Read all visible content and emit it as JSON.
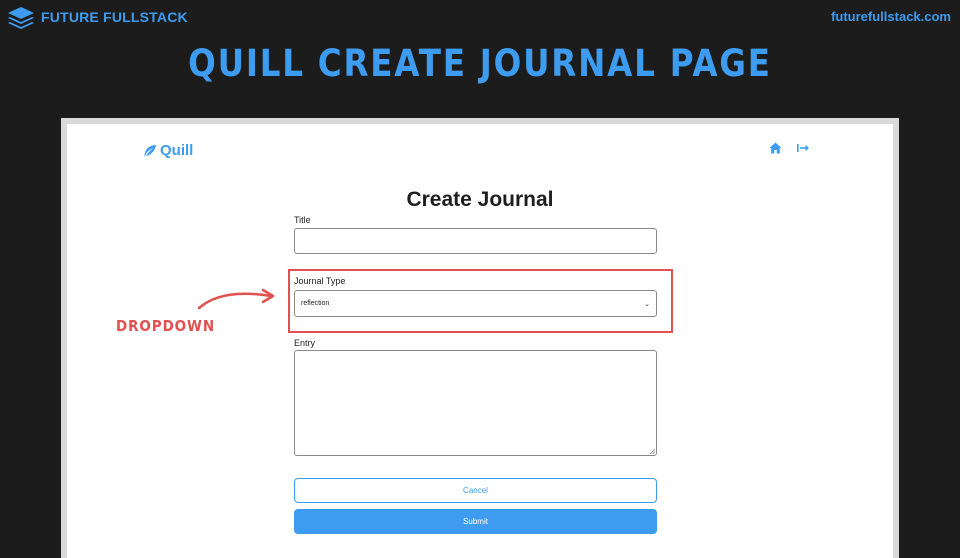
{
  "header": {
    "brand_name": "FUTURE FULLSTACK",
    "site_url": "futurefullstack.com",
    "slide_title": "QUILL CREATE JOURNAL PAGE"
  },
  "app": {
    "logo_text": "Quill",
    "nav": {
      "icons": [
        "home-icon",
        "logout-icon"
      ]
    },
    "page_title": "Create Journal",
    "form": {
      "title_label": "Title",
      "title_value": "",
      "journal_type_label": "Journal Type",
      "journal_type_value": "reflection",
      "entry_label": "Entry",
      "entry_value": "",
      "cancel_label": "Cancel",
      "submit_label": "Submit"
    }
  },
  "annotation": {
    "callout_label": "DROPDOWN"
  },
  "colors": {
    "accent": "#3d9cef",
    "annotation": "#e05150",
    "background": "#1c1c1c"
  }
}
